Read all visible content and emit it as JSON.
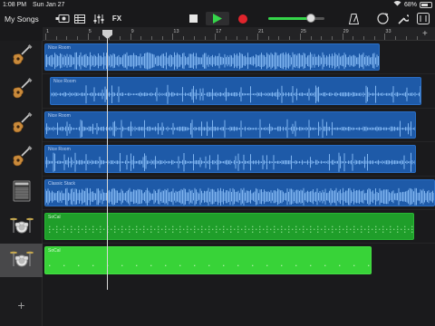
{
  "status_bar": {
    "time": "1:08 PM",
    "date": "Sun Jan 27",
    "battery": "68%"
  },
  "toolbar": {
    "my_songs_label": "My Songs",
    "fx_label": "FX",
    "volume_level": 0.75
  },
  "ruler": {
    "bar_labels": [
      "1",
      "5",
      "9",
      "13",
      "17",
      "21",
      "25",
      "29",
      "33"
    ]
  },
  "tracks": [
    {
      "icon": "acoustic-guitar-icon",
      "selected": false
    },
    {
      "icon": "acoustic-guitar-icon",
      "selected": false
    },
    {
      "icon": "acoustic-guitar-icon",
      "selected": false
    },
    {
      "icon": "acoustic-guitar-icon",
      "selected": false
    },
    {
      "icon": "guitar-amp-icon",
      "selected": false
    },
    {
      "icon": "drum-kit-icon",
      "selected": false
    },
    {
      "icon": "drum-kit-icon",
      "selected": true
    }
  ],
  "regions": [
    {
      "name": "Nice Room",
      "kind": "audio"
    },
    {
      "name": "Nice Room",
      "kind": "audio"
    },
    {
      "name": "Nice Room",
      "kind": "audio"
    },
    {
      "name": "Nice Room",
      "kind": "audio"
    },
    {
      "name": "Classic Stack",
      "kind": "audio"
    },
    {
      "name": "SoCal",
      "kind": "drum"
    },
    {
      "name": "SoCal",
      "kind": "drum"
    }
  ],
  "colors": {
    "audio_region": "#1e5aa8",
    "drum_region": "#1f9e2a",
    "selected_drum_region": "#38d338",
    "play_accent": "#35d54a",
    "record": "#e0242c"
  }
}
